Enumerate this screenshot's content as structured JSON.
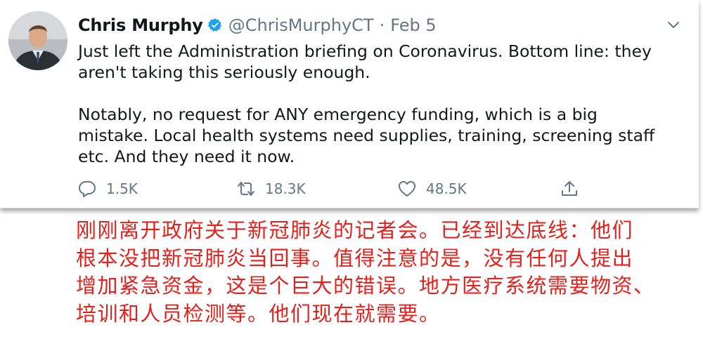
{
  "tweet": {
    "author_name": "Chris Murphy",
    "handle": "@ChrisMurphyCT",
    "separator": "·",
    "date": "Feb 5",
    "paragraphs": [
      "Just left the Administration briefing on Coronavirus. Bottom line: they\naren't taking this seriously enough.",
      "Notably, no request for ANY emergency funding, which is a big\nmistake. Local health systems need supplies, training, screening staff\netc. And they need it now."
    ],
    "actions": {
      "replies": "1.5K",
      "retweets": "18.3K",
      "likes": "48.5K"
    },
    "icons": [
      "verified-badge-icon",
      "chevron-down-icon",
      "reply-icon",
      "retweet-icon",
      "like-icon",
      "share-icon"
    ],
    "colors": {
      "verified": "#1da1f2",
      "secondary_text": "#657786",
      "text": "#14171a"
    }
  },
  "translation": {
    "lines": [
      "刚刚离开政府关于新冠肺炎的记者会。已经到达底线：他们",
      "根本没把新冠肺炎当回事。值得注意的是，没有任何人提出",
      "增加紧急资金，这是个巨大的错误。地方医疗系统需要物资、",
      "培训和人员检测等。他们现在就需要。"
    ],
    "color": "#e3211c"
  }
}
